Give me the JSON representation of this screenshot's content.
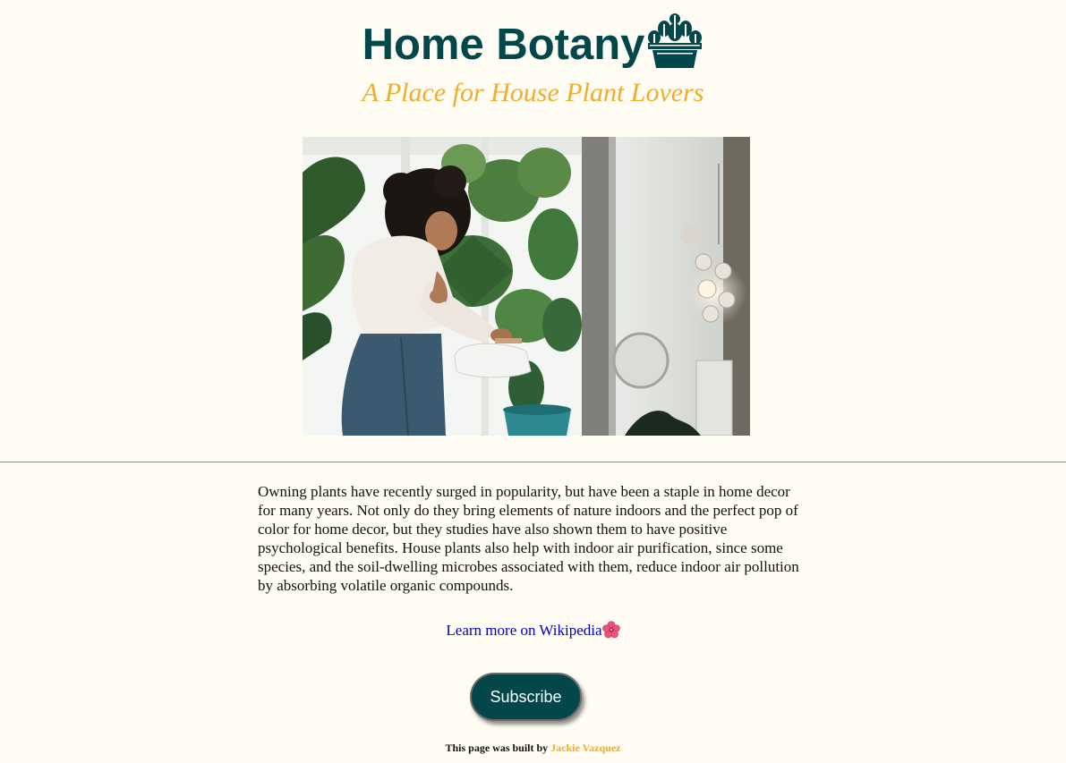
{
  "header": {
    "title": "Home Botany",
    "logo_icon": "potted-plant-icon",
    "subtitle": "A Place for House Plant Lovers"
  },
  "hero": {
    "image": "woman-watering-plants-photo"
  },
  "content": {
    "paragraph": "Owning plants have recently surged in popularity, but have been a staple in home decor for many years. Not only do they bring elements of nature indoors and the perfect pop of color for home decor, but they studies have also shown them to have positive psychological benefits. House plants also help with indoor air purification, since some species, and the soil-dwelling microbes associated with them, reduce indoor air pollution by absorbing volatile organic compounds.",
    "link_label": "Learn more on Wikipedia",
    "link_icon": "hibiscus-icon"
  },
  "subscribe_label": "Subscribe",
  "footer": {
    "prefix": "This page was built by ",
    "author": "Jackie Vazquez"
  },
  "colors": {
    "background": "#fffcf4",
    "brand_green": "#02474a",
    "accent_gold": "#f0ad2a",
    "link_blue": "#0000d0"
  }
}
